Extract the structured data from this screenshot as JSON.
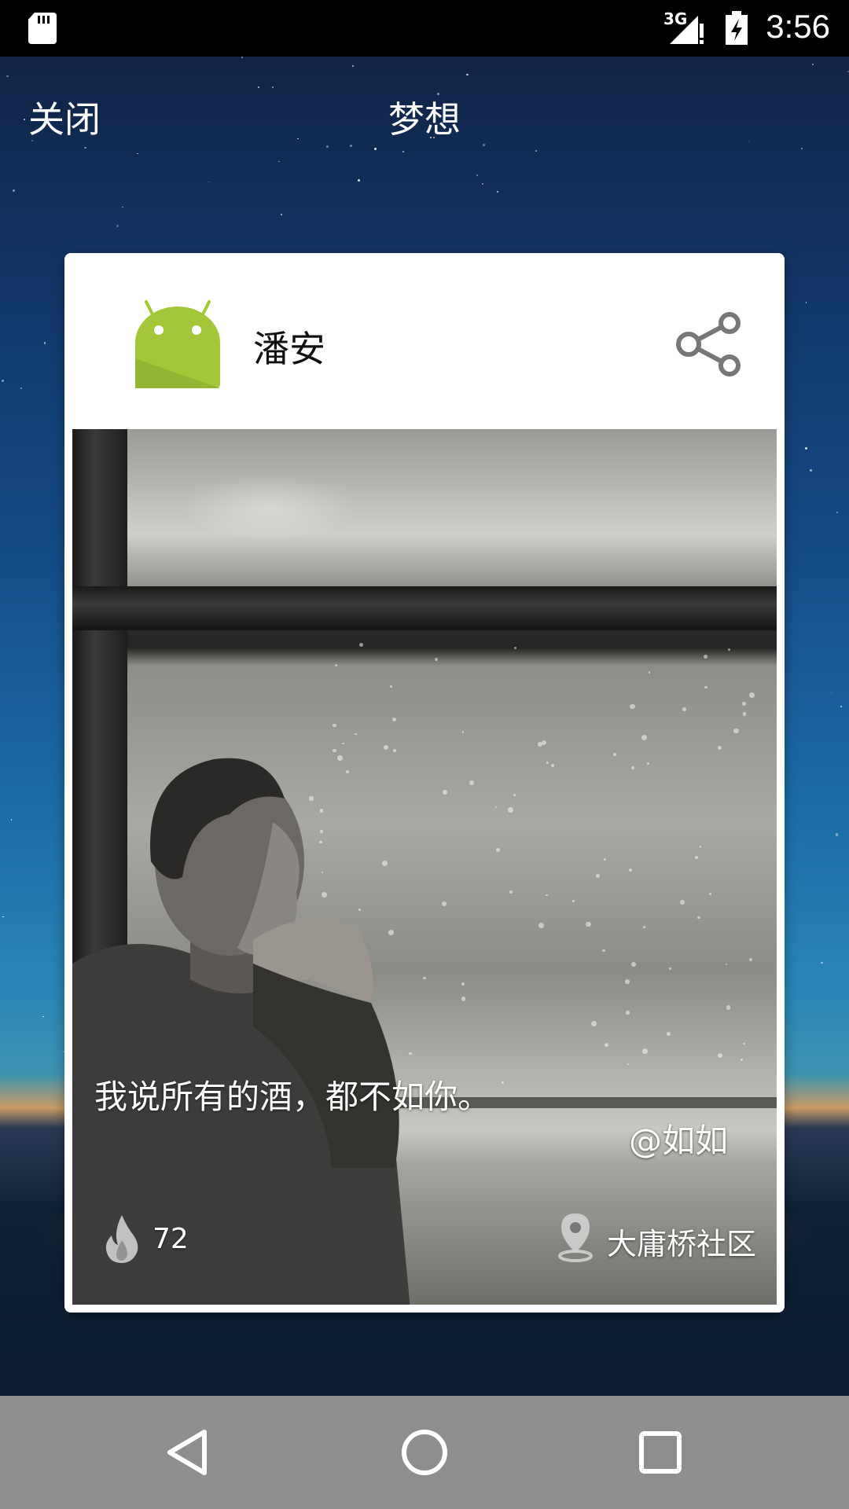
{
  "status_bar": {
    "network": "3G",
    "time": "3:56",
    "icons": [
      "sd-card-icon",
      "signal-icon",
      "battery-charging-icon"
    ]
  },
  "top_bar": {
    "close_label": "关闭",
    "title": "梦想"
  },
  "card": {
    "user_name": "潘安",
    "avatar_icon": "android-avatar-icon",
    "share_icon": "share-icon",
    "quote": "我说所有的酒，都不如你。",
    "author": "@如如",
    "heat_count": "72",
    "heat_icon": "flame-icon",
    "location": "大庸桥社区",
    "location_icon": "location-pin-icon"
  },
  "nav_bar": {
    "icons": [
      "back-icon",
      "home-icon",
      "recents-icon"
    ]
  },
  "colors": {
    "android_green": "#a4c639",
    "nav_bar": "#8e8e8e",
    "sky_top": "#0f2346",
    "sky_horizon": "#c99b66"
  }
}
